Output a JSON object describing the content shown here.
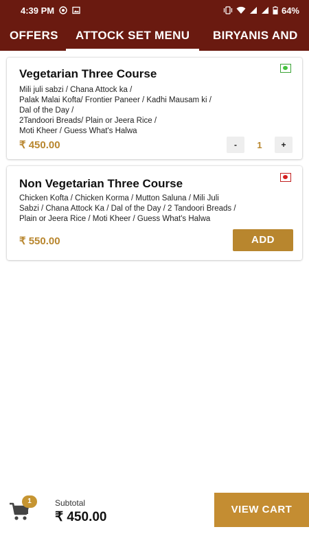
{
  "status_bar": {
    "time": "4:39 PM",
    "battery": "64%"
  },
  "tabs": [
    {
      "label": "OFFERS",
      "active": false
    },
    {
      "label": "ATTOCK SET MENU",
      "active": true
    },
    {
      "label": "BIRYANIS AND",
      "active": false
    }
  ],
  "items": [
    {
      "title": "Vegetarian Three Course",
      "type": "veg",
      "description_lines": [
        "Mili juli sabzi / Chana Attock ka /",
        "Palak Malai Kofta/ Frontier Paneer / Kadhi Mausam ki  /",
        "Dal of the Day /",
        "2Tandoori Breads/ Plain or Jeera Rice /",
        "Moti Kheer / Guess What's Halwa"
      ],
      "price": "₹ 450.00",
      "quantity": "1",
      "decrement_label": "-",
      "increment_label": "+"
    },
    {
      "title": "Non Vegetarian Three Course",
      "type": "non-veg",
      "description_lines": [
        "Chicken Kofta / Chicken  Korma / Mutton Saluna /  Mili Juli",
        "Sabzi / Chana Attock Ka / Dal of the Day / 2 Tandoori Breads /",
        "Plain or Jeera Rice /  Moti Kheer / Guess What's Halwa"
      ],
      "price": "₹ 550.00",
      "add_label": "ADD"
    }
  ],
  "bottom_bar": {
    "cart_count": "1",
    "subtotal_label": "Subtotal",
    "subtotal_value": "₹ 450.00",
    "view_cart_label": "VIEW CART"
  },
  "colors": {
    "header": "#6a1a10",
    "accent": "#b8862e",
    "veg": "#3aa335",
    "non_veg": "#c12020"
  },
  "icons": [
    "whatsapp-icon",
    "gallery-icon",
    "vibrate-icon",
    "wifi-icon",
    "signal-icon",
    "battery-icon",
    "veg-indicator-icon",
    "non-veg-indicator-icon",
    "cart-icon"
  ]
}
